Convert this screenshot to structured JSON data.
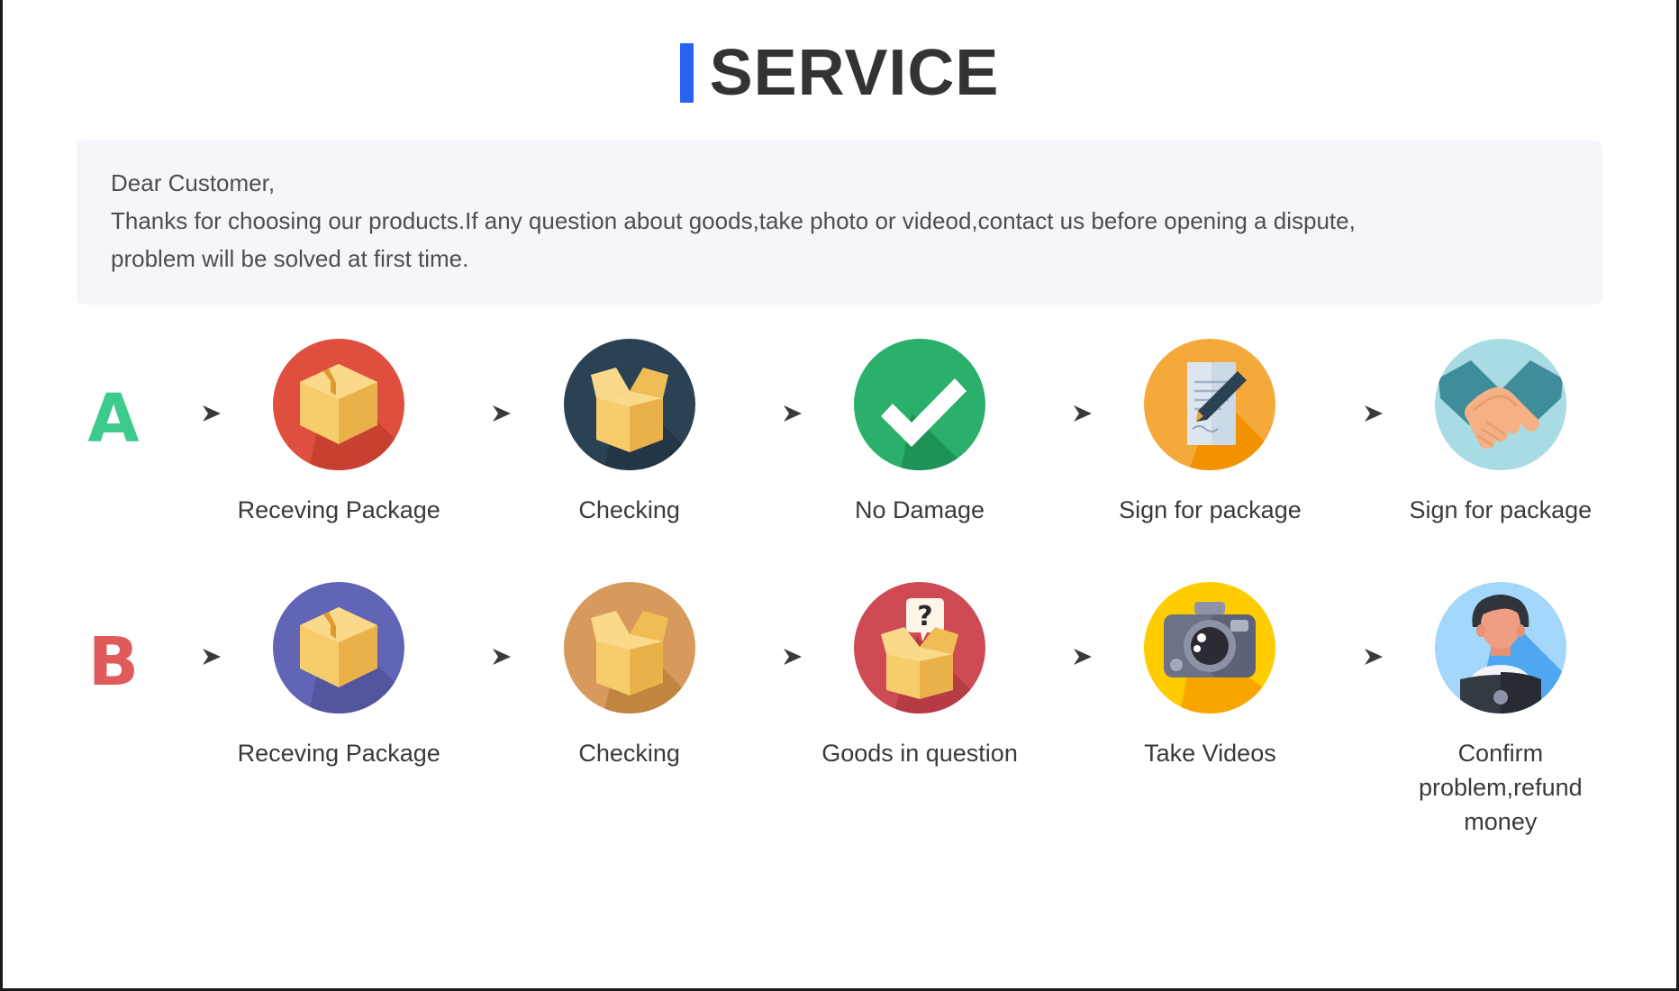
{
  "page": {
    "title": "SERVICE",
    "accent_color": "#2563f0",
    "title_color": "#333333",
    "background": "#ffffff",
    "border_color": "#1a1a1a"
  },
  "notice": {
    "background": "#f4f6fb",
    "line1": "Dear Customer,",
    "line2": "Thanks for choosing our products.If any question about goods,take photo or videod,contact us before opening a dispute,",
    "line3": "problem will be solved at first time."
  },
  "flows": [
    {
      "letter": "A",
      "letter_color": "#3ccb8c",
      "arrow_glyph": "→",
      "steps": [
        {
          "label": "Receving Package",
          "icon": "package-box-icon",
          "circle_color": "#df4f3e",
          "shade_color": "#c8402f"
        },
        {
          "label": "Checking",
          "icon": "open-box-icon",
          "circle_color": "#2b4254",
          "shade_color": "#223646"
        },
        {
          "label": "No Damage",
          "icon": "check-mark-icon",
          "circle_color": "#2ab06a",
          "shade_color": "#1f9357"
        },
        {
          "label": "Sign for package",
          "icon": "document-pen-icon",
          "circle_color": "#f5a93b",
          "shade_color": "#f29200"
        },
        {
          "label": "Sign for package",
          "icon": "handshake-icon",
          "circle_color": "#a8dbe3",
          "shade_color": "#3f8d9a"
        }
      ]
    },
    {
      "letter": "B",
      "letter_color": "#e05b5b",
      "arrow_glyph": "→",
      "steps": [
        {
          "label": "Receving Package",
          "icon": "package-box-icon",
          "circle_color": "#6265b5",
          "shade_color": "#53569e"
        },
        {
          "label": "Checking",
          "icon": "open-box-icon",
          "circle_color": "#d79a5c",
          "shade_color": "#c2843f"
        },
        {
          "label": "Goods in question",
          "icon": "question-box-icon",
          "circle_color": "#cf4b54",
          "shade_color": "#b63b45"
        },
        {
          "label": "Take Videos",
          "icon": "camera-icon",
          "circle_color": "#ffcc00",
          "shade_color": "#f9a500"
        },
        {
          "label": "Confirm problem,refund money",
          "icon": "support-agent-icon",
          "circle_color": "#a3d7fb",
          "shade_color": "#4ea7f0"
        }
      ]
    }
  ]
}
